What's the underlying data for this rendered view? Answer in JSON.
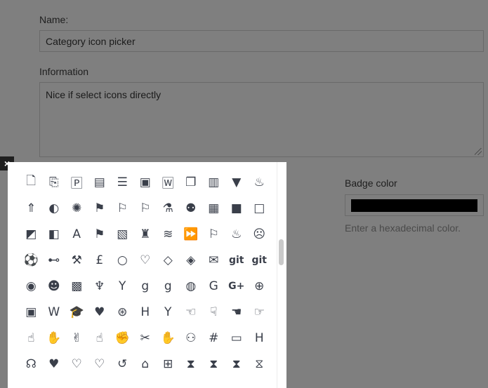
{
  "form": {
    "name_label": "Name:",
    "name_value": "Category icon picker",
    "info_label": "Information",
    "info_value": "Nice if select icons directly",
    "badge_label": "Badge color",
    "badge_color": "#000000",
    "badge_help": "Enter a hexadecimal color."
  },
  "picker": {
    "close_label": "×",
    "icons": [
      {
        "name": "file-o-icon",
        "g": "🗋"
      },
      {
        "name": "file-pdf-o-icon",
        "g": "⎘"
      },
      {
        "name": "file-powerpoint-o-icon",
        "g": "🄿"
      },
      {
        "name": "file-text-icon",
        "g": "▤"
      },
      {
        "name": "file-text-o-icon",
        "g": "☰"
      },
      {
        "name": "file-video-o-icon",
        "g": "▣"
      },
      {
        "name": "file-word-o-icon",
        "g": "🅆"
      },
      {
        "name": "files-o-icon",
        "g": "❐"
      },
      {
        "name": "film-icon",
        "g": "▥"
      },
      {
        "name": "filter-icon",
        "g": "▼"
      },
      {
        "name": "fire-icon",
        "g": "♨"
      },
      {
        "name": "fire-extinguisher-icon",
        "g": "⇑"
      },
      {
        "name": "firefox-icon",
        "g": "◐"
      },
      {
        "name": "first-order-icon",
        "g": "✺"
      },
      {
        "name": "flag-icon",
        "g": "⚑"
      },
      {
        "name": "flag-checkered-icon",
        "g": "⚐"
      },
      {
        "name": "flag-o-icon",
        "g": "⚐"
      },
      {
        "name": "flask-icon",
        "g": "⚗"
      },
      {
        "name": "flickr-icon",
        "g": "⚉"
      },
      {
        "name": "floppy-o-icon",
        "g": "▦"
      },
      {
        "name": "folder-icon",
        "g": "■"
      },
      {
        "name": "folder-o-icon",
        "g": "□"
      },
      {
        "name": "folder-open-icon",
        "g": "◩"
      },
      {
        "name": "folder-open-o-icon",
        "g": "◧"
      },
      {
        "name": "font-icon",
        "g": "A"
      },
      {
        "name": "font-awesome-icon",
        "g": "⚑"
      },
      {
        "name": "fonticons-icon",
        "g": "▧"
      },
      {
        "name": "fort-awesome-icon",
        "g": "♜"
      },
      {
        "name": "forumbee-icon",
        "g": "≋"
      },
      {
        "name": "forward-icon",
        "g": "⏩"
      },
      {
        "name": "foursquare-icon",
        "g": "⚐"
      },
      {
        "name": "free-code-camp-icon",
        "g": "♨"
      },
      {
        "name": "frown-o-icon",
        "g": "☹"
      },
      {
        "name": "futbol-o-icon",
        "g": "⚽"
      },
      {
        "name": "gamepad-icon",
        "g": "⊷"
      },
      {
        "name": "gavel-icon",
        "g": "⚒"
      },
      {
        "name": "gbp-icon",
        "g": "£"
      },
      {
        "name": "genderless-icon",
        "g": "○"
      },
      {
        "name": "get-pocket-icon",
        "g": "♡"
      },
      {
        "name": "gg-icon",
        "g": "◇"
      },
      {
        "name": "gg-circle-icon",
        "g": "◈"
      },
      {
        "name": "gift-icon",
        "g": "✉"
      },
      {
        "name": "git-icon",
        "g": "git"
      },
      {
        "name": "git-square-icon",
        "g": "git"
      },
      {
        "name": "github-icon",
        "g": "◉"
      },
      {
        "name": "github-alt-icon",
        "g": "☻"
      },
      {
        "name": "github-square-icon",
        "g": "▩"
      },
      {
        "name": "gitlab-icon",
        "g": "♆"
      },
      {
        "name": "glass-icon",
        "g": "Y"
      },
      {
        "name": "glide-icon",
        "g": "g"
      },
      {
        "name": "glide-g-icon",
        "g": "g"
      },
      {
        "name": "globe-icon",
        "g": "◍"
      },
      {
        "name": "google-icon",
        "g": "G"
      },
      {
        "name": "google-plus-icon",
        "g": "G+"
      },
      {
        "name": "google-plus-circle-icon",
        "g": "⊕"
      },
      {
        "name": "google-plus-square-icon",
        "g": "▣"
      },
      {
        "name": "google-wallet-icon",
        "g": "W"
      },
      {
        "name": "graduation-cap-icon",
        "g": "🎓"
      },
      {
        "name": "gratipay-icon",
        "g": "♥"
      },
      {
        "name": "grav-icon",
        "g": "⊛"
      },
      {
        "name": "h-square-icon",
        "g": "H"
      },
      {
        "name": "hacker-news-icon",
        "g": "Y"
      },
      {
        "name": "hand-lizard-o-icon",
        "g": "☜"
      },
      {
        "name": "hand-o-down-icon",
        "g": "☟"
      },
      {
        "name": "hand-o-left-icon",
        "g": "☚"
      },
      {
        "name": "hand-o-right-icon",
        "g": "☞"
      },
      {
        "name": "hand-o-up-icon",
        "g": "☝"
      },
      {
        "name": "hand-paper-o-icon",
        "g": "✋"
      },
      {
        "name": "hand-peace-o-icon",
        "g": "✌"
      },
      {
        "name": "hand-pointer-o-icon",
        "g": "☝"
      },
      {
        "name": "hand-rock-o-icon",
        "g": "✊"
      },
      {
        "name": "hand-scissors-o-icon",
        "g": "✂"
      },
      {
        "name": "hand-spock-o-icon",
        "g": "✋"
      },
      {
        "name": "handshake-o-icon",
        "g": "⚇"
      },
      {
        "name": "hashtag-icon",
        "g": "#"
      },
      {
        "name": "hdd-o-icon",
        "g": "▭"
      },
      {
        "name": "header-icon",
        "g": "H"
      },
      {
        "name": "headphones-icon",
        "g": "☊"
      },
      {
        "name": "heart-icon",
        "g": "♥"
      },
      {
        "name": "heart-o-icon",
        "g": "♡"
      },
      {
        "name": "heartbeat-icon",
        "g": "♡"
      },
      {
        "name": "history-icon",
        "g": "↺"
      },
      {
        "name": "home-icon",
        "g": "⌂"
      },
      {
        "name": "hospital-o-icon",
        "g": "⊞"
      },
      {
        "name": "hourglass-icon",
        "g": "⧗"
      },
      {
        "name": "hourglass-end-icon",
        "g": "⧗"
      },
      {
        "name": "hourglass-half-icon",
        "g": "⧗"
      },
      {
        "name": "hourglass-o-icon",
        "g": "⧖"
      }
    ]
  }
}
